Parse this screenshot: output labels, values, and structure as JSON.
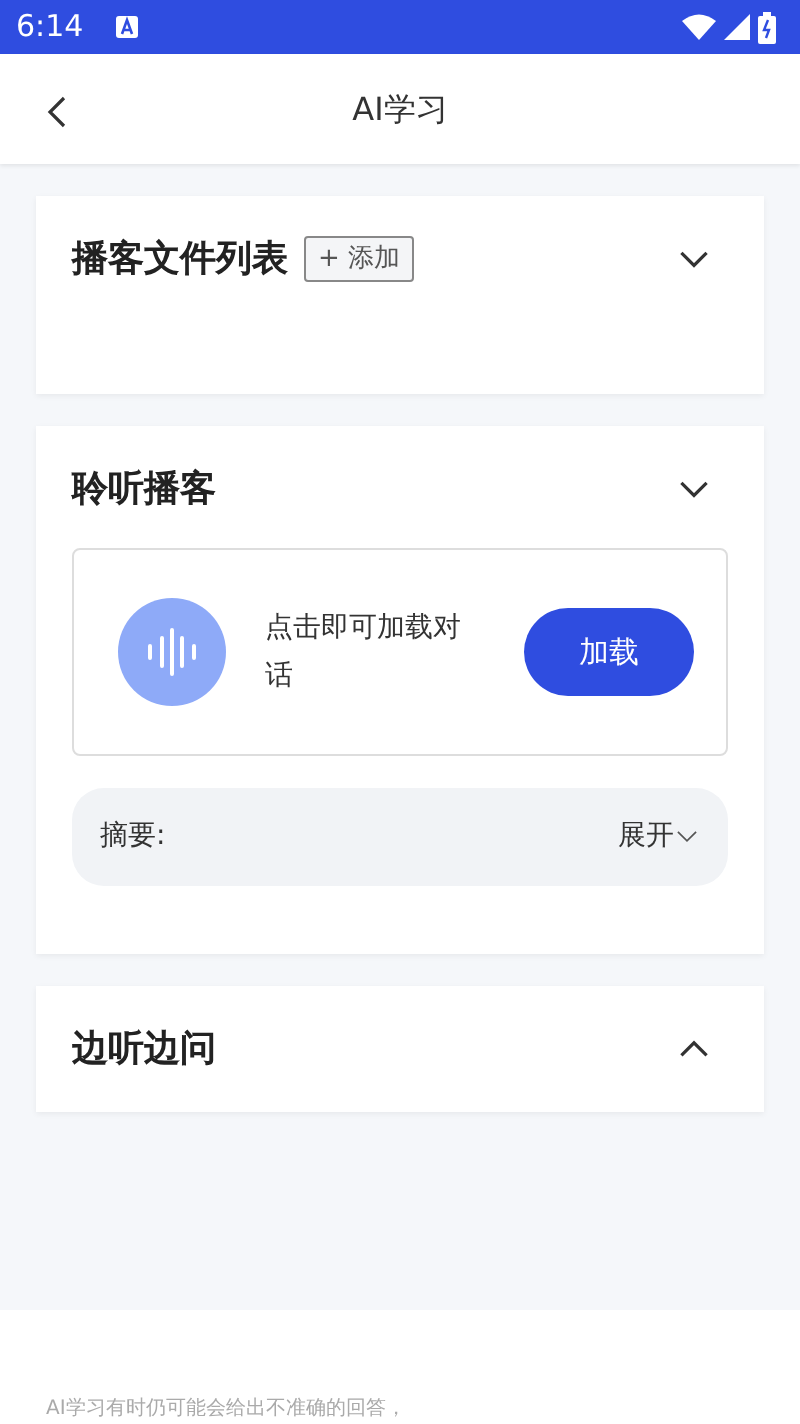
{
  "status_bar": {
    "time": "6:14"
  },
  "header": {
    "title": "AI学习"
  },
  "sections": [
    {
      "title": "播客文件列表",
      "add_button": "+ 添加",
      "expanded": true
    },
    {
      "title": "聆听播客",
      "expanded": true,
      "load_card": {
        "text": "点击即可加载对话",
        "button": "加载"
      },
      "summary": {
        "label": "摘要:",
        "toggle": "展开",
        "expanded": false
      }
    },
    {
      "title": "边听边问",
      "expanded": false
    }
  ],
  "footer": {
    "note": "AI学习有时仍可能会给出不准确的回答，"
  }
}
